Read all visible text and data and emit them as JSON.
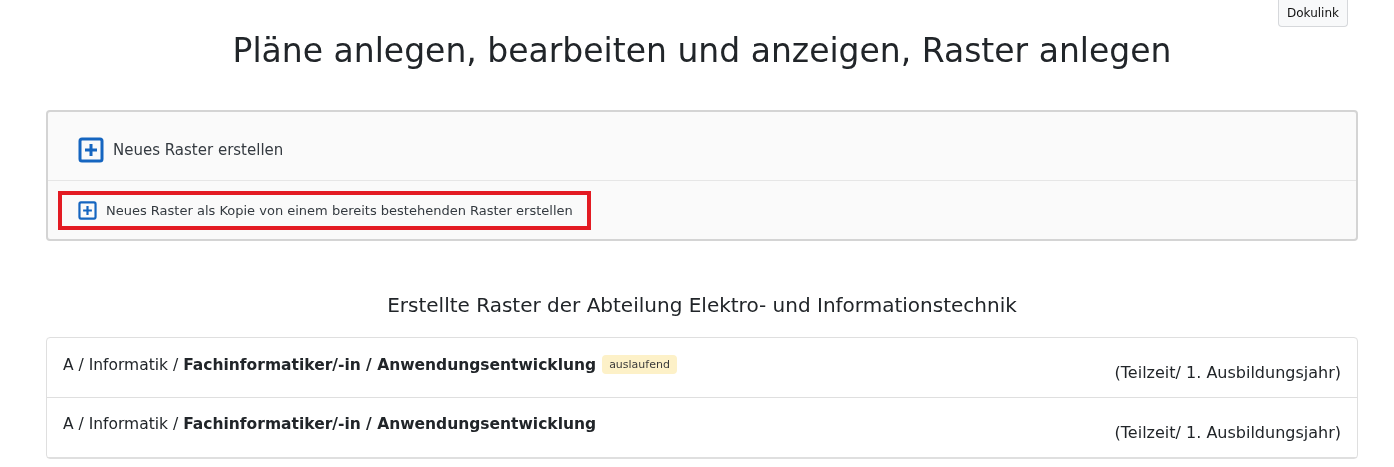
{
  "doc_button": "Dokulink",
  "title": "Pläne anlegen, bearbeiten und anzeigen, Raster anlegen",
  "actions": [
    {
      "label": "Neues Raster erstellen",
      "kind": "primary",
      "highlighted": false
    },
    {
      "label": "Neues Raster als Kopie von einem bereits bestehenden Raster erstellen",
      "kind": "secondary",
      "highlighted": true
    }
  ],
  "section_title": "Erstellte Raster der Abteilung Elektro- und Informationstechnik",
  "rasters": [
    {
      "path": "A / Informatik / **Fachinformatiker/-in / Anwendungsentwicklung**",
      "badge": "auslaufend",
      "details": "(Teilzeit/ 1. Ausbildungsjahr)"
    },
    {
      "path": "A / Informatik / **Fachinformatiker/-in / Anwendungsentwicklung**",
      "details": "(Teilzeit/ 1. Ausbildungsjahr)"
    }
  ]
}
